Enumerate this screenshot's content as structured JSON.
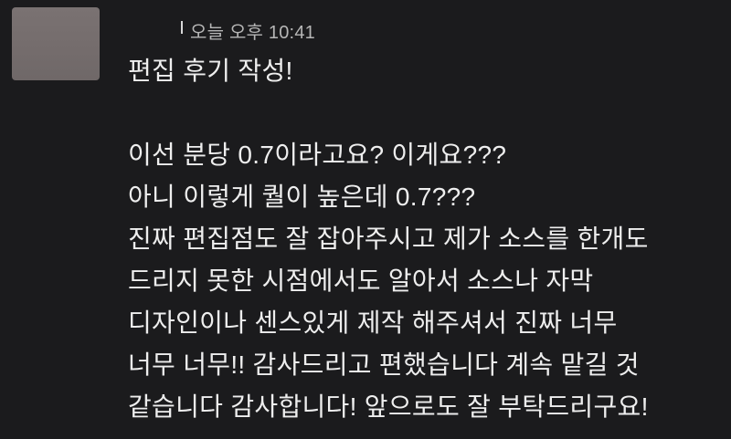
{
  "chat": {
    "timestamp": "오늘 오후 10:41",
    "message": {
      "title": "편집 후기 작성!",
      "lines": [
        "이선 분당 0.7이라고요? 이게요???",
        "아니 이렇게 퀄이 높은데 0.7???",
        "진짜 편집점도 잘 잡아주시고 제가 소스를 한개도",
        "드리지 못한 시점에서도 알아서 소스나 자막",
        "디자인이나 센스있게 제작 해주셔서 진짜 너무",
        "너무 너무!! 감사드리고 편했습니다 계속 맡길 것",
        "같습니다 감사합니다! 앞으로도 잘 부탁드리구요!"
      ]
    }
  }
}
